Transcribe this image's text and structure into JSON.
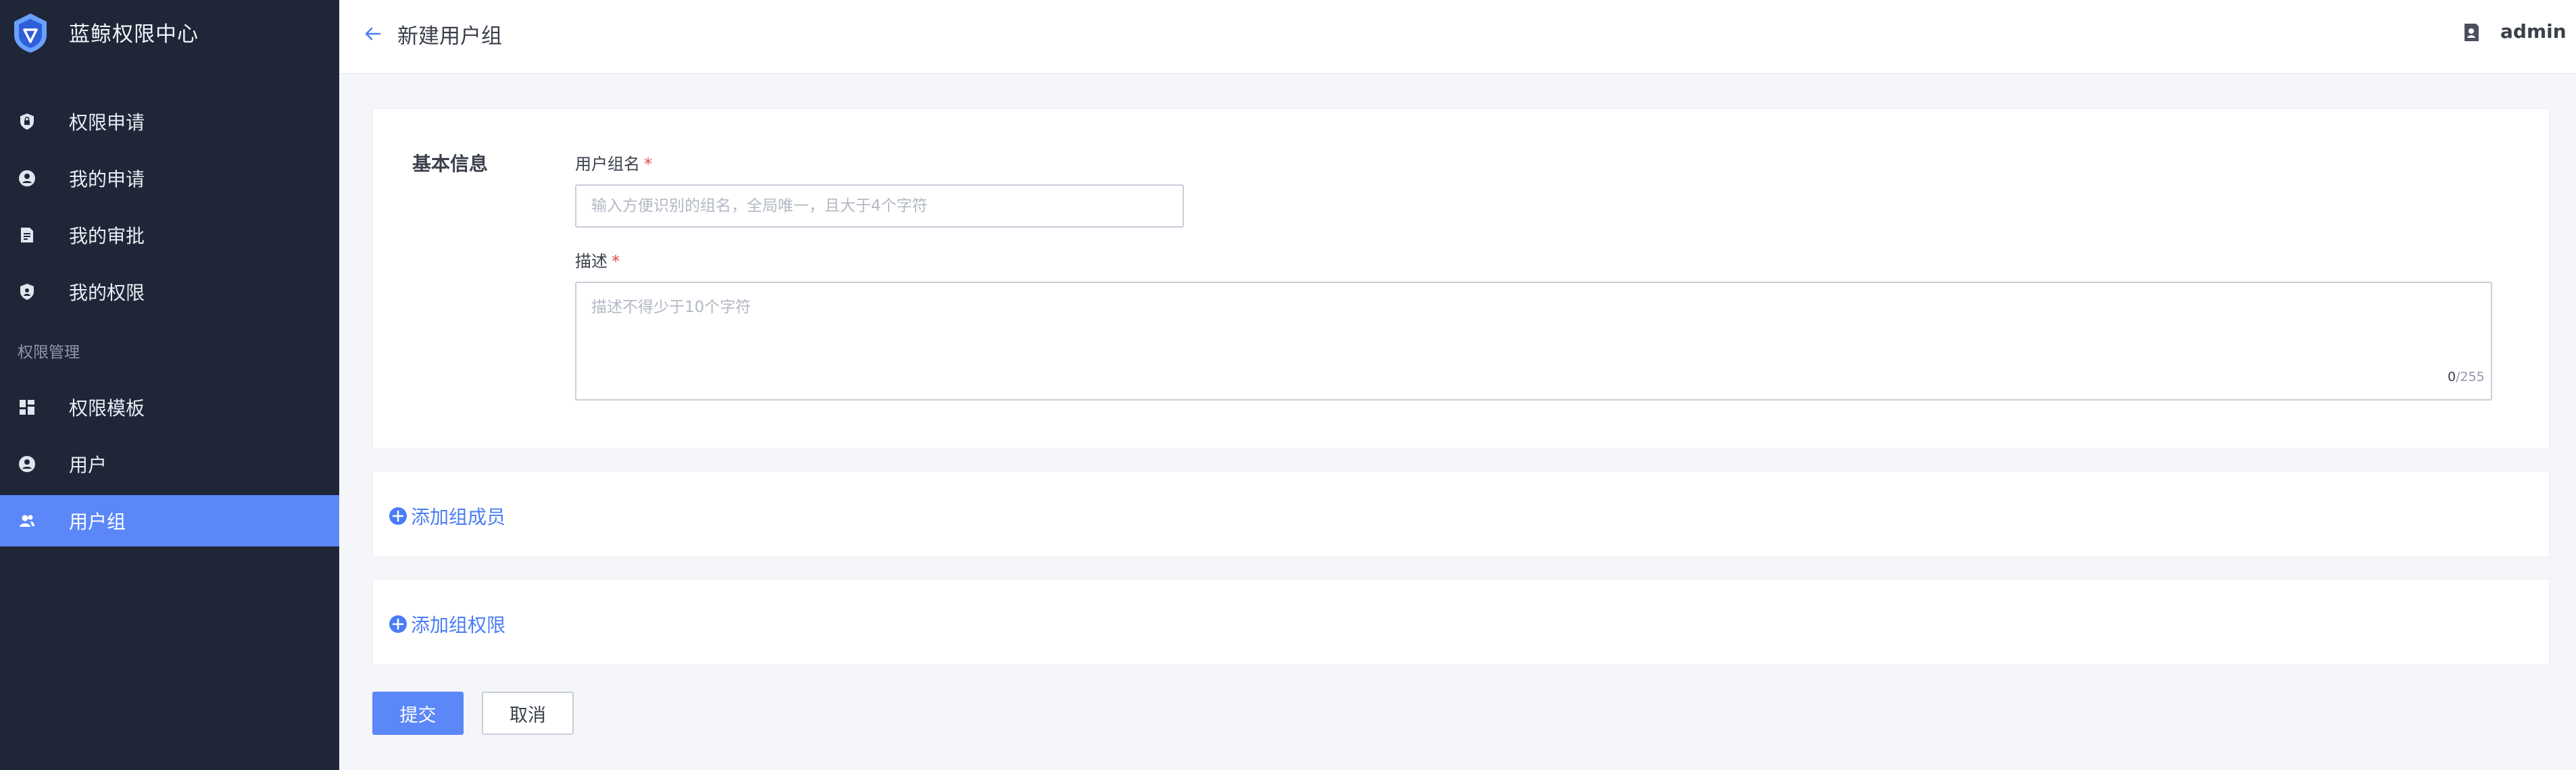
{
  "app": {
    "title": "蓝鲸权限中心"
  },
  "sidebar": {
    "items": [
      {
        "label": "权限申请",
        "icon": "shield-lock-icon"
      },
      {
        "label": "我的申请",
        "icon": "user-circle-icon"
      },
      {
        "label": "我的审批",
        "icon": "document-icon"
      },
      {
        "label": "我的权限",
        "icon": "shield-user-icon"
      }
    ],
    "group_label": "权限管理",
    "admin_items": [
      {
        "label": "权限模板",
        "icon": "grid-icon"
      },
      {
        "label": "用户",
        "icon": "user-icon"
      },
      {
        "label": "用户组",
        "icon": "users-icon",
        "active": true
      }
    ]
  },
  "header": {
    "title": "新建用户组",
    "user": "admin"
  },
  "form": {
    "section_title": "基本信息",
    "name_label": "用户组名",
    "name_placeholder": "输入方便识别的组名，全局唯一，且大于4个字符",
    "name_value": "",
    "desc_label": "描述",
    "desc_placeholder": "描述不得少于10个字符",
    "desc_value": "",
    "counter_current": "0",
    "counter_max": "/255",
    "required_mark": "*"
  },
  "actions": {
    "add_members": "添加组成员",
    "add_permissions": "添加组权限",
    "submit": "提交",
    "cancel": "取消"
  },
  "colors": {
    "sidebar_bg": "#1f2638",
    "accent": "#5b87f8",
    "link": "#4a7cf6",
    "required": "#e5484d"
  }
}
